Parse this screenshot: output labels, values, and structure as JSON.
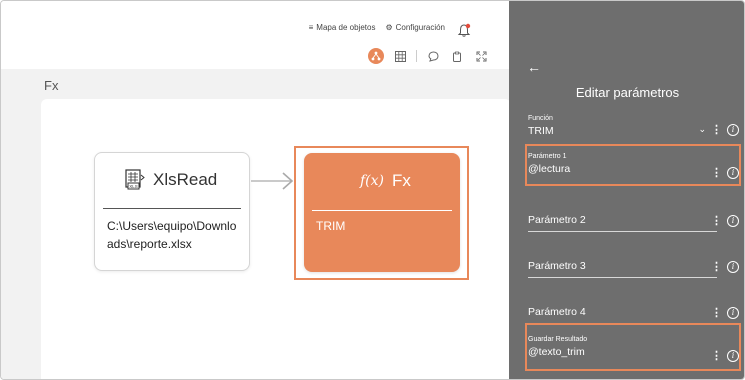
{
  "topnav": {
    "object_map_label": "Mapa de objetos",
    "settings_label": "Configuración"
  },
  "canvas": {
    "title": "Fx"
  },
  "nodes": {
    "xls": {
      "title": "XlsRead",
      "path": "C:\\Users\\equipo\\Downloads\\reporte.xlsx"
    },
    "fx": {
      "title": "Fx",
      "function": "TRIM"
    }
  },
  "panel": {
    "title": "Editar parámetros",
    "function_label": "Función",
    "function_value": "TRIM",
    "param1_label": "Parámetro 1",
    "param1_value": "@lectura",
    "param2_placeholder": "Parámetro 2",
    "param3_placeholder": "Parámetro 3",
    "param4_placeholder": "Parámetro 4",
    "result_label": "Guardar Resultado",
    "result_value": "@texto_trim"
  },
  "colors": {
    "accent": "#e8885a",
    "panel_bg": "#6e6e6e"
  }
}
